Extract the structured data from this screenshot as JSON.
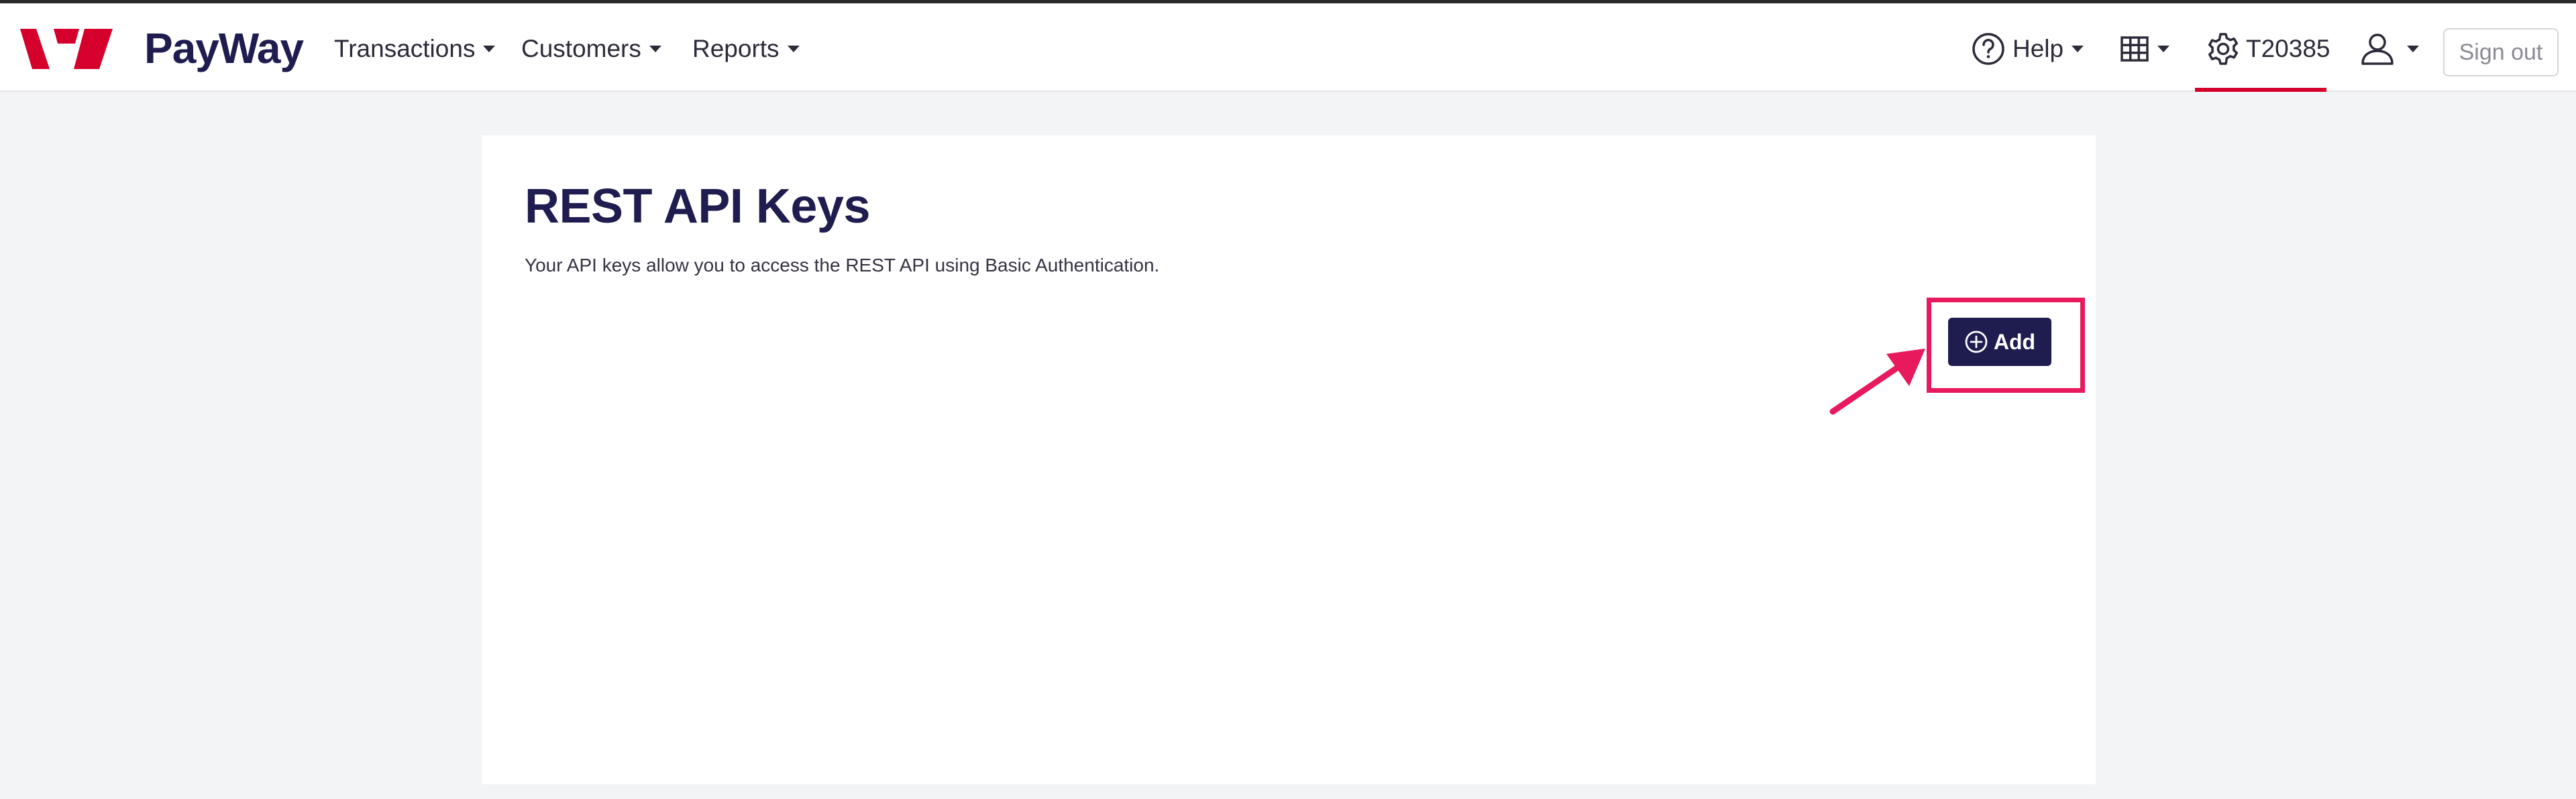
{
  "brand": {
    "name": "PayWay",
    "logo_icon": "westpac-logo-icon"
  },
  "nav": {
    "items": [
      {
        "label": "Transactions"
      },
      {
        "label": "Customers"
      },
      {
        "label": "Reports"
      }
    ],
    "help_label": "Help",
    "grid_icon": "apps-grid-icon",
    "settings_label": "T20385",
    "user_icon": "user-icon",
    "sign_out_label": "Sign out"
  },
  "page": {
    "title": "REST API Keys",
    "description": "Your API keys allow you to access the REST API using Basic Authentication.",
    "add_label": "Add"
  },
  "colors": {
    "brand_navy": "#1f1c4f",
    "brand_red": "#d5002b",
    "annotation_pink": "#e8195c",
    "page_bg": "#f3f4f6"
  }
}
